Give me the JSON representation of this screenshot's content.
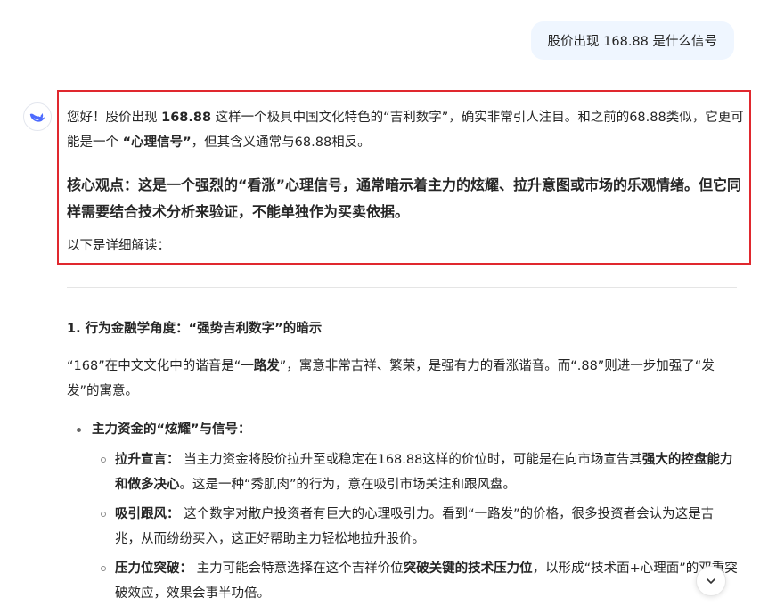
{
  "user_message": "股价出现 168.88 是什么信号",
  "assistant": {
    "intro": {
      "t1": "您好！股价出现 ",
      "t2": "168.88",
      "t3": " 这样一个极具中国文化特色的“吉利数字”，确实非常引人注目。和之前的68.88类似，它更可能是一个 ",
      "t4": "“心理信号”",
      "t5": "，但其含义通常与68.88相反。"
    },
    "core": "核心观点：这是一个强烈的“看涨”心理信号，通常暗示着主力的炫耀、拉升意图或市场的乐观情绪。但它同样需要结合技术分析来验证，不能单独作为买卖依据。",
    "lead": "以下是详细解读：",
    "section1": {
      "heading": "1. 行为金融学角度：“强势吉利数字”的暗示",
      "para": {
        "t1": "“168”在中文文化中的谐音是“",
        "t2": "一路发",
        "t3": "”，寓意非常吉祥、繁荣，是强有力的看涨谐音。而“.88”则进一步加强了“发发”的寓意。"
      },
      "bullet": {
        "label": "主力资金的“炫耀”与信号：",
        "sub": [
          {
            "label": "拉升宣言：",
            "t1": " 当主力资金将股价拉升至或稳定在168.88这样的价位时，可能是在向市场宣告其",
            "t2": "强大的控盘能力和做多决心",
            "t3": "。这是一种“秀肌肉”的行为，意在吸引市场关注和跟风盘。"
          },
          {
            "label": "吸引跟风：",
            "t1": " 这个数字对散户投资者有巨大的心理吸引力。看到“一路发”的价格，很多投资者会认为这是吉兆，从而纷纷买入，这正好帮助主力轻松地拉升股价。",
            "t2": "",
            "t3": ""
          },
          {
            "label": "压力位突破：",
            "t1": " 主力可能会特意选择在这个吉祥价位",
            "t2": "突破关键的技术压力位",
            "t3": "，以形成“技术面+心理面”的双重突破效应，效果会事半功倍。"
          }
        ]
      }
    }
  },
  "icons": {
    "avatar": "deepseek-whale-icon",
    "scroll": "chevron-down-icon"
  },
  "colors": {
    "highlight_border": "#e0282e",
    "user_bubble": "#eff6ff",
    "avatar_accent": "#4d6bfe"
  }
}
